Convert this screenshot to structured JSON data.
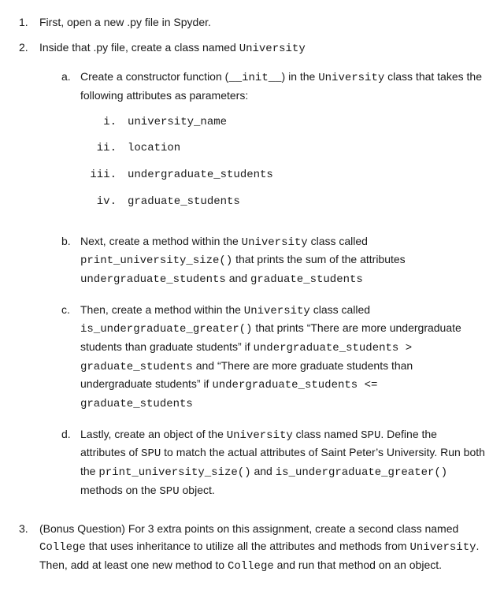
{
  "items": {
    "1": {
      "num": "1.",
      "text_before": "First, open a new .py file in Spyder."
    },
    "2": {
      "num": "2.",
      "text_before": "Inside that .py file, create a class named ",
      "code1": "University",
      "sub": {
        "a": {
          "num": "a.",
          "t1": "Create a constructor function (",
          "c1": "__init__",
          "t2": ") in the ",
          "c2": "University",
          "t3": " class that takes the following attributes as parameters:",
          "roman": {
            "i": {
              "num": "i.",
              "code": "university_name"
            },
            "ii": {
              "num": "ii.",
              "code": "location"
            },
            "iii": {
              "num": "iii.",
              "code": "undergraduate_students"
            },
            "iv": {
              "num": "iv.",
              "code": "graduate_students"
            }
          }
        },
        "b": {
          "num": "b.",
          "t1": "Next, create a method within the ",
          "c1": "University",
          "t2": " class called ",
          "c2": "print_university_size()",
          "t3": " that prints the sum of the attributes ",
          "c3": "undergraduate_students",
          "t4": " and ",
          "c4": "graduate_students"
        },
        "c": {
          "num": "c.",
          "t1": "Then, create a method within the ",
          "c1": "University",
          "t2": " class called ",
          "c2": "is_undergraduate_greater()",
          "t3": " that prints “There are more undergraduate students than graduate students” if ",
          "c3": "undergraduate_students > graduate_students",
          "t4": " and “There are more graduate students than undergraduate students” if ",
          "c4": "undergraduate_students <= graduate_students"
        },
        "d": {
          "num": "d.",
          "t1": "Lastly, create an object of the ",
          "c1": "University",
          "t2": " class named ",
          "c2": "SPU",
          "t3": ". Define the attributes of ",
          "c3": "SPU",
          "t4": " to match the actual attributes of Saint Peter’s University. Run both the ",
          "c4": "print_university_size()",
          "t5": " and ",
          "c5": "is_undergraduate_greater()",
          "t6": " methods on the ",
          "c6": "SPU",
          "t7": " object."
        }
      }
    },
    "3": {
      "num": "3.",
      "t1": "(Bonus Question) For 3 extra points on this assignment, create a second class named ",
      "c1": "College",
      "t2": " that uses inheritance to utilize all the attributes and methods from ",
      "c2": "University",
      "t3": ". Then, add at least one new method to ",
      "c3": "College",
      "t4": " and run that method on an object."
    }
  }
}
